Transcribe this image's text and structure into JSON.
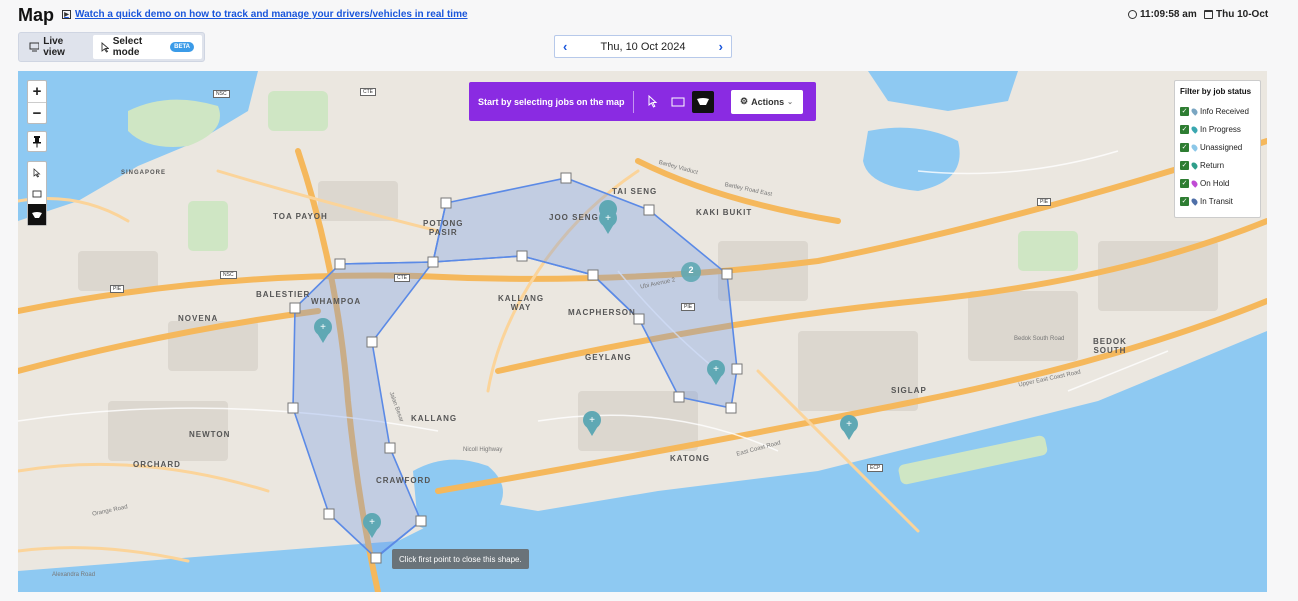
{
  "header": {
    "title": "Map",
    "demo_link": "Watch a quick demo on how to track and manage your drivers/vehicles in real time",
    "time": "11:09:58 am",
    "date_short": "Thu 10-Oct"
  },
  "mode_toggle": {
    "live_view": "Live view",
    "select_mode": "Select mode",
    "badge": "BETA"
  },
  "date_picker": {
    "date": "Thu, 10 Oct 2024",
    "prev_icon": "chevron-left-icon",
    "next_icon": "chevron-right-icon"
  },
  "map_controls": {
    "zoom_in": "+",
    "zoom_out": "−"
  },
  "job_toolbar": {
    "message": "Start by selecting jobs on the map",
    "actions_label": "Actions"
  },
  "filter": {
    "title": "Filter by job status",
    "items": [
      {
        "label": "Info Received",
        "color": "#7aa6c2"
      },
      {
        "label": "In Progress",
        "color": "#3aa7b0"
      },
      {
        "label": "Unassigned",
        "color": "#8cc7e8"
      },
      {
        "label": "Return",
        "color": "#2e9e8a"
      },
      {
        "label": "On Hold",
        "color": "#c04bd4"
      },
      {
        "label": "In Transit",
        "color": "#4f6fa8"
      }
    ]
  },
  "map": {
    "tooltip": "Click first point to close this shape.",
    "cluster_count": "2",
    "place_labels": {
      "toa_payoh": "TOA PAYOH",
      "balestier": "BALESTIER",
      "whampoa": "WHAMPOA",
      "novena": "NOVENA",
      "newton": "NEWTON",
      "orchard": "ORCHARD",
      "kallang": "KALLANG",
      "kallang_way": "KALLANG\nWAY",
      "potong_pasir": "POTONG\nPASIR",
      "joo_seng": "JOO SENG",
      "tai_seng": "TAI SENG",
      "kaki_bukit": "KAKI BUKIT",
      "macpherson": "MACPHERSON",
      "geylang": "GEYLANG",
      "katong": "KATONG",
      "crawford": "CRAWFORD",
      "siglap": "SIGLAP",
      "bedok_south": "BEDOK\nSOUTH",
      "singapore": "SINGAPORE"
    },
    "road_labels": {
      "ubi_avenue": "Ubi Avenue 2",
      "bedok_south_road": "Bedok South Road",
      "upper_east_coast": "Upper East Coast Road",
      "east_coast_road": "East Coast Road",
      "nicoll_highway": "Nicoll Highway",
      "orange_road": "Orange Road",
      "alexandra_road": "Alexandra Road",
      "bartley_viaduct": "Bartley Viaduct",
      "bartley_road_east": "Bartley Road East",
      "jalan_besar": "Jalan Besar"
    },
    "shields": {
      "pie_1": "PIE",
      "pie_2": "PIE",
      "pie_3": "PIE",
      "cte_1": "CTE",
      "cte_2": "CTE",
      "nsc_1": "NSC",
      "nsc_2": "NSC",
      "ecp": "ECP"
    }
  }
}
